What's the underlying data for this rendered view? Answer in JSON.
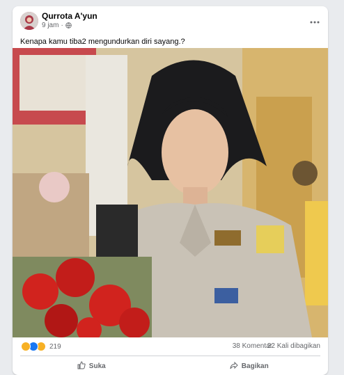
{
  "post": {
    "author": "Qurrota A'yun",
    "time": "9 jam",
    "separator": "·",
    "caption": "Kenapa kamu tiba2 mengundurkan diri sayang.?",
    "more_icon": "more-horizontal-icon",
    "privacy_icon": "globe-icon"
  },
  "stats": {
    "reaction_count": "219",
    "reaction_icons": [
      "haha-icon",
      "like-icon",
      "wow-icon"
    ],
    "comments": "38 Komentar",
    "shares": "22 Kali dibagikan"
  },
  "actions": {
    "like_label": "Suka",
    "share_label": "Bagikan"
  },
  "colors": {
    "background": "#e9ebee",
    "card": "#ffffff",
    "text_secondary": "#65676b",
    "like_blue": "#1877f2",
    "reaction_yellow": "#f7b125"
  }
}
